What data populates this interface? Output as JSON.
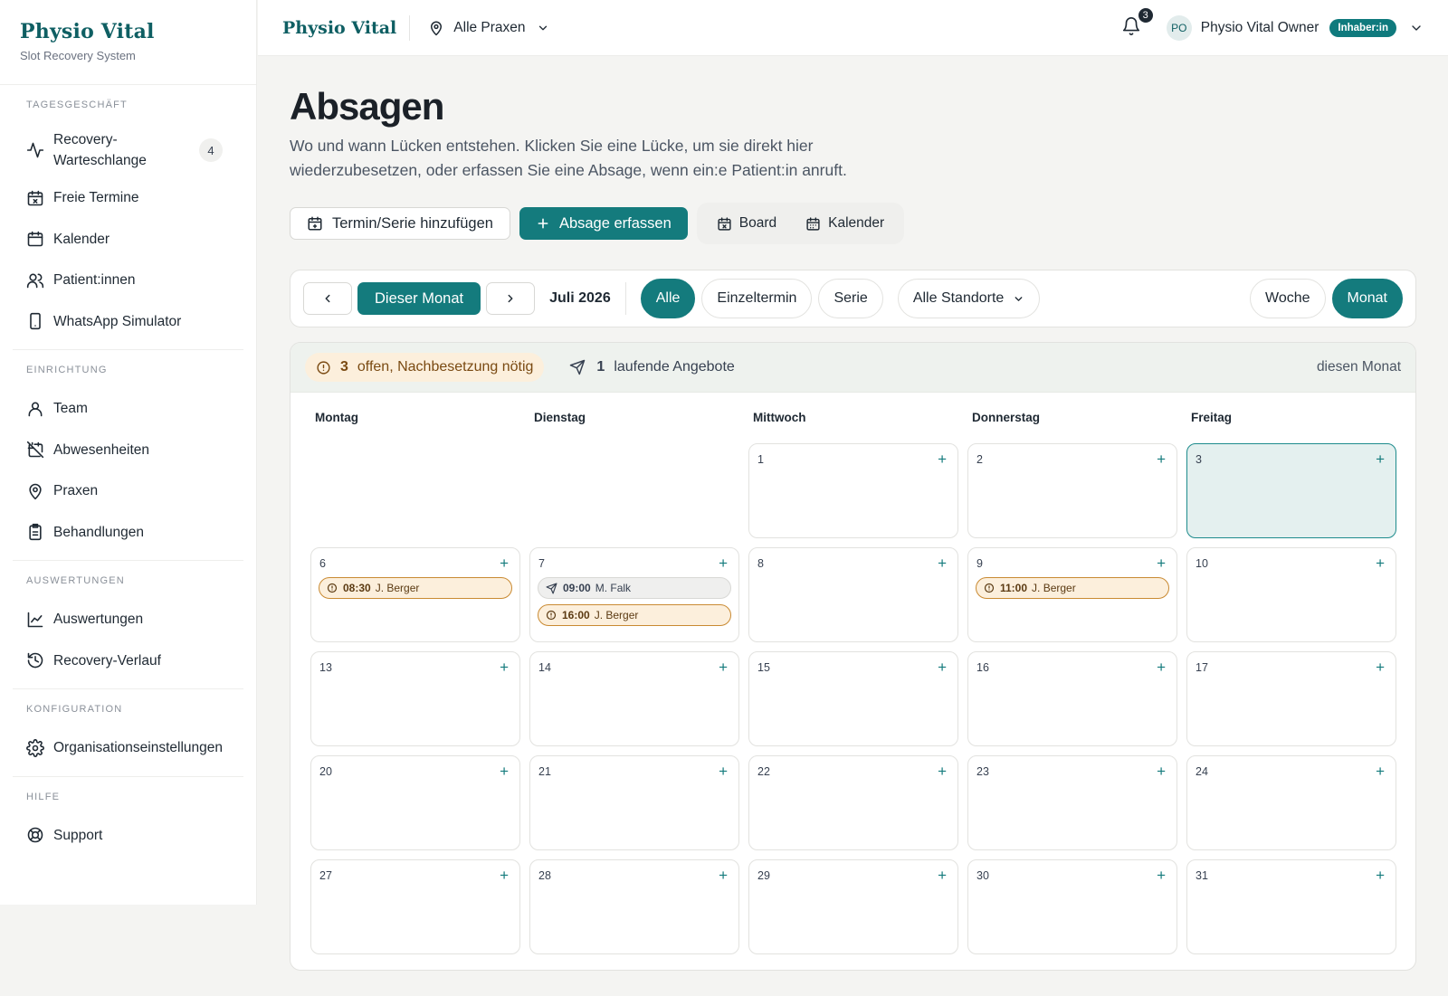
{
  "brand": {
    "title": "Physio Vital",
    "subtitle": "Slot Recovery System"
  },
  "sidebar": {
    "sections": [
      {
        "heading": "TAGESGESCHÄFT",
        "items": [
          {
            "label": "Recovery-Warteschlange",
            "icon": "activity-icon",
            "badge": "4"
          },
          {
            "label": "Freie Termine",
            "icon": "calendar-x-icon"
          },
          {
            "label": "Kalender",
            "icon": "calendar-icon"
          },
          {
            "label": "Patient:innen",
            "icon": "users-icon"
          },
          {
            "label": "WhatsApp Simulator",
            "icon": "smartphone-icon"
          }
        ]
      },
      {
        "heading": "EINRICHTUNG",
        "items": [
          {
            "label": "Team",
            "icon": "user-icon"
          },
          {
            "label": "Abwesenheiten",
            "icon": "calendar-off-icon"
          },
          {
            "label": "Praxen",
            "icon": "map-pin-icon"
          },
          {
            "label": "Behandlungen",
            "icon": "clipboard-icon"
          }
        ]
      },
      {
        "heading": "AUSWERTUNGEN",
        "items": [
          {
            "label": "Auswertungen",
            "icon": "line-chart-icon"
          },
          {
            "label": "Recovery-Verlauf",
            "icon": "history-icon"
          }
        ]
      },
      {
        "heading": "KONFIGURATION",
        "items": [
          {
            "label": "Organisationseinstellungen",
            "icon": "gear-icon"
          }
        ]
      },
      {
        "heading": "HILFE",
        "items": [
          {
            "label": "Support",
            "icon": "lifebuoy-icon"
          }
        ]
      }
    ]
  },
  "topbar": {
    "brand": "Physio Vital",
    "location_select": "Alle Praxen",
    "notifications": "3",
    "avatar_initials": "PO",
    "user_name": "Physio Vital Owner",
    "role": "Inhaber:in"
  },
  "page": {
    "title": "Absagen",
    "description": "Wo und wann Lücken entstehen. Klicken Sie eine Lücke, um sie direkt hier wiederzubesetzen, oder erfassen Sie eine Absage, wenn ein:e Patient:in anruft.",
    "add_button": "Termin/Serie hinzufügen",
    "record_button": "Absage erfassen",
    "view_board": "Board",
    "view_calendar": "Kalender"
  },
  "filters": {
    "this_month": "Dieser Monat",
    "month_label": "Juli 2026",
    "type_all": "Alle",
    "type_single": "Einzeltermin",
    "type_series": "Serie",
    "location": "Alle Standorte",
    "view_week": "Woche",
    "view_month": "Monat"
  },
  "summary": {
    "open_count": "3",
    "open_label": "offen, Nachbesetzung nötig",
    "offers_count": "1",
    "offers_label": "laufende Angebote",
    "scope": "diesen Monat"
  },
  "calendar": {
    "weekdays": [
      "Montag",
      "Dienstag",
      "Mittwoch",
      "Donnerstag",
      "Freitag"
    ],
    "add_symbol": "+",
    "weeks": [
      [
        null,
        null,
        {
          "day": "1",
          "events": []
        },
        {
          "day": "2",
          "events": []
        },
        {
          "day": "3",
          "events": [],
          "today": true
        }
      ],
      [
        {
          "day": "6",
          "events": [
            {
              "time": "08:30",
              "name": "J. Berger",
              "status": "open"
            }
          ]
        },
        {
          "day": "7",
          "events": [
            {
              "time": "09:00",
              "name": "M. Falk",
              "status": "offer"
            },
            {
              "time": "16:00",
              "name": "J. Berger",
              "status": "open"
            }
          ]
        },
        {
          "day": "8",
          "events": []
        },
        {
          "day": "9",
          "events": [
            {
              "time": "11:00",
              "name": "J. Berger",
              "status": "open"
            }
          ]
        },
        {
          "day": "10",
          "events": []
        }
      ],
      [
        {
          "day": "13",
          "events": []
        },
        {
          "day": "14",
          "events": []
        },
        {
          "day": "15",
          "events": []
        },
        {
          "day": "16",
          "events": []
        },
        {
          "day": "17",
          "events": []
        }
      ],
      [
        {
          "day": "20",
          "events": []
        },
        {
          "day": "21",
          "events": []
        },
        {
          "day": "22",
          "events": []
        },
        {
          "day": "23",
          "events": []
        },
        {
          "day": "24",
          "events": []
        }
      ],
      [
        {
          "day": "27",
          "events": []
        },
        {
          "day": "28",
          "events": []
        },
        {
          "day": "29",
          "events": []
        },
        {
          "day": "30",
          "events": []
        },
        {
          "day": "31",
          "events": []
        }
      ]
    ]
  },
  "colors": {
    "brand": "#0f5f63",
    "primary": "#147b7d",
    "open_bg": "#fcefdc",
    "open_border": "#c98a32",
    "summary_bg": "#eef2ee"
  }
}
